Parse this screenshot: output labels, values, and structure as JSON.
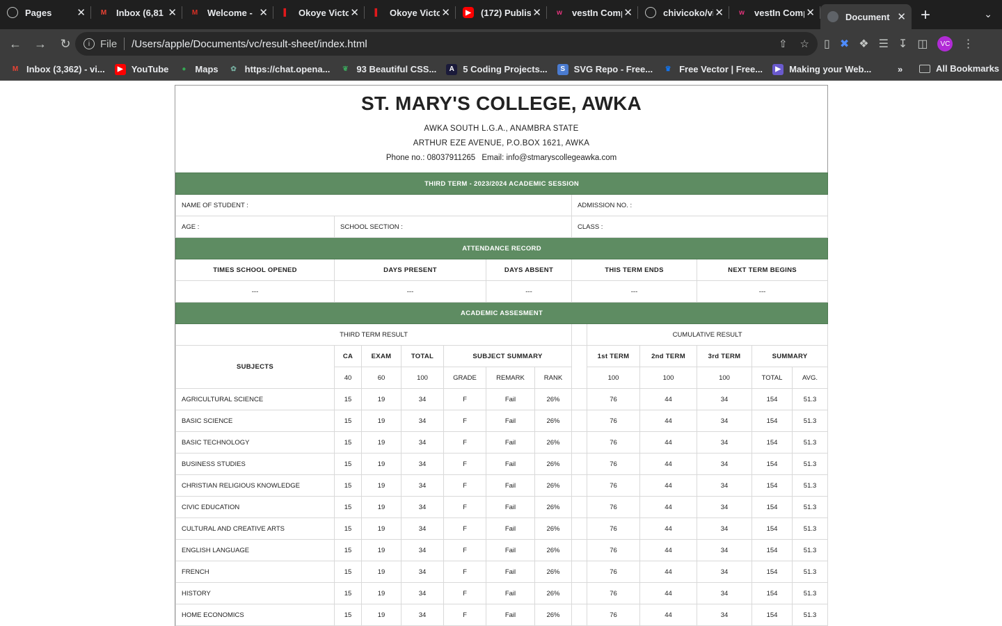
{
  "browser": {
    "tabs": [
      {
        "title": "Pages",
        "icon": "github-icon",
        "active": false
      },
      {
        "title": "Inbox (6,81",
        "icon": "gmail-icon",
        "active": false
      },
      {
        "title": "Welcome -",
        "icon": "mail-icon",
        "active": false
      },
      {
        "title": "Okoye Victo",
        "icon": "red-bar-icon",
        "active": false
      },
      {
        "title": "Okoye Victo",
        "icon": "red-bar-icon",
        "active": false
      },
      {
        "title": "(172) Publis",
        "icon": "youtube-icon",
        "active": false
      },
      {
        "title": "vestIn Comp",
        "icon": "w-icon",
        "active": false
      },
      {
        "title": "chivicoko/vi",
        "icon": "github-icon",
        "active": false
      },
      {
        "title": "vestIn Comp",
        "icon": "w-icon",
        "active": false
      },
      {
        "title": "Document",
        "icon": "globe-icon",
        "active": true
      }
    ],
    "new_tab": "+",
    "address": {
      "scheme": "File",
      "url": "/Users/apple/Documents/vc/result-sheet/index.html"
    },
    "profile_initials": "VC",
    "bookmarks": [
      {
        "label": "Inbox (3,362) - vi...",
        "icon": "gmail-icon"
      },
      {
        "label": "YouTube",
        "icon": "youtube-icon"
      },
      {
        "label": "Maps",
        "icon": "maps-icon"
      },
      {
        "label": "https://chat.opena...",
        "icon": "chatgpt-icon"
      },
      {
        "label": "93 Beautiful CSS...",
        "icon": "css-icon"
      },
      {
        "label": "5 Coding Projects...",
        "icon": "coding-icon"
      },
      {
        "label": "SVG Repo - Free...",
        "icon": "svgrepo-icon"
      },
      {
        "label": "Free Vector | Free...",
        "icon": "freepik-icon"
      },
      {
        "label": "Making your Web...",
        "icon": "web-icon"
      }
    ],
    "more_bookmarks": "»",
    "all_bookmarks": "All Bookmarks"
  },
  "school": {
    "name": "ST. MARY'S COLLEGE, AWKA",
    "lga": "AWKA SOUTH L.G.A., ANAMBRA STATE",
    "address": "ARTHUR EZE AVENUE, P.O.BOX 1621, AWKA",
    "phone": "Phone no.: 08037911265",
    "email": "Email: info@stmaryscollegeawka.com"
  },
  "session": "THIRD TERM - 2023/2024 ACADEMIC SESSION",
  "student": {
    "name_label": "NAME OF STUDENT :",
    "admission_label": "ADMISSION NO. :",
    "age_label": "AGE :",
    "section_label": "SCHOOL SECTION :",
    "class_label": "CLASS :"
  },
  "attendance": {
    "title": "ATTENDANCE RECORD",
    "headers": [
      "TIMES SCHOOL OPENED",
      "DAYS PRESENT",
      "DAYS ABSENT",
      "THIS TERM ENDS",
      "NEXT TERM BEGINS"
    ],
    "values": [
      "---",
      "---",
      "---",
      "---",
      "---"
    ]
  },
  "assessment": {
    "title": "ACADEMIC ASSESMENT",
    "third_term_label": "THIRD TERM RESULT",
    "cumulative_label": "CUMULATIVE RESULT",
    "subjects_label": "SUBJECTS",
    "headers": {
      "ca": "CA",
      "exam": "EXAM",
      "total": "TOTAL",
      "summary": "SUBJECT SUMMARY",
      "t1": "1st TERM",
      "t2": "2nd TERM",
      "t3": "3rd TERM",
      "cum_summary": "SUMMARY"
    },
    "subheaders": {
      "ca": "40",
      "exam": "60",
      "total": "100",
      "grade": "GRADE",
      "remark": "REMARK",
      "rank": "RANK",
      "t1": "100",
      "t2": "100",
      "t3": "100",
      "cum_total": "TOTAL",
      "avg": "AVG."
    },
    "rows": [
      {
        "subject": "AGRICULTURAL SCIENCE",
        "ca": "15",
        "exam": "19",
        "total": "34",
        "grade": "F",
        "remark": "Fail",
        "rank": "26%",
        "t1": "76",
        "t2": "44",
        "t3": "34",
        "cum_total": "154",
        "avg": "51.3"
      },
      {
        "subject": "BASIC SCIENCE",
        "ca": "15",
        "exam": "19",
        "total": "34",
        "grade": "F",
        "remark": "Fail",
        "rank": "26%",
        "t1": "76",
        "t2": "44",
        "t3": "34",
        "cum_total": "154",
        "avg": "51.3"
      },
      {
        "subject": "BASIC TECHNOLOGY",
        "ca": "15",
        "exam": "19",
        "total": "34",
        "grade": "F",
        "remark": "Fail",
        "rank": "26%",
        "t1": "76",
        "t2": "44",
        "t3": "34",
        "cum_total": "154",
        "avg": "51.3"
      },
      {
        "subject": "BUSINESS STUDIES",
        "ca": "15",
        "exam": "19",
        "total": "34",
        "grade": "F",
        "remark": "Fail",
        "rank": "26%",
        "t1": "76",
        "t2": "44",
        "t3": "34",
        "cum_total": "154",
        "avg": "51.3"
      },
      {
        "subject": "CHRISTIAN RELIGIOUS KNOWLEDGE",
        "ca": "15",
        "exam": "19",
        "total": "34",
        "grade": "F",
        "remark": "Fail",
        "rank": "26%",
        "t1": "76",
        "t2": "44",
        "t3": "34",
        "cum_total": "154",
        "avg": "51.3"
      },
      {
        "subject": "CIVIC EDUCATION",
        "ca": "15",
        "exam": "19",
        "total": "34",
        "grade": "F",
        "remark": "Fail",
        "rank": "26%",
        "t1": "76",
        "t2": "44",
        "t3": "34",
        "cum_total": "154",
        "avg": "51.3"
      },
      {
        "subject": "CULTURAL AND CREATIVE ARTS",
        "ca": "15",
        "exam": "19",
        "total": "34",
        "grade": "F",
        "remark": "Fail",
        "rank": "26%",
        "t1": "76",
        "t2": "44",
        "t3": "34",
        "cum_total": "154",
        "avg": "51.3"
      },
      {
        "subject": "ENGLISH LANGUAGE",
        "ca": "15",
        "exam": "19",
        "total": "34",
        "grade": "F",
        "remark": "Fail",
        "rank": "26%",
        "t1": "76",
        "t2": "44",
        "t3": "34",
        "cum_total": "154",
        "avg": "51.3"
      },
      {
        "subject": "FRENCH",
        "ca": "15",
        "exam": "19",
        "total": "34",
        "grade": "F",
        "remark": "Fail",
        "rank": "26%",
        "t1": "76",
        "t2": "44",
        "t3": "34",
        "cum_total": "154",
        "avg": "51.3"
      },
      {
        "subject": "HISTORY",
        "ca": "15",
        "exam": "19",
        "total": "34",
        "grade": "F",
        "remark": "Fail",
        "rank": "26%",
        "t1": "76",
        "t2": "44",
        "t3": "34",
        "cum_total": "154",
        "avg": "51.3"
      },
      {
        "subject": "HOME ECONOMICS",
        "ca": "15",
        "exam": "19",
        "total": "34",
        "grade": "F",
        "remark": "Fail",
        "rank": "26%",
        "t1": "76",
        "t2": "44",
        "t3": "34",
        "cum_total": "154",
        "avg": "51.3"
      },
      {
        "subject": "",
        "ca": "",
        "exam": "",
        "total": "",
        "grade": "",
        "remark": "",
        "rank": "",
        "t1": "",
        "t2": "",
        "t3": "",
        "cum_total": "",
        "avg": ""
      }
    ]
  },
  "colors": {
    "band": "#5e8c62",
    "chrome_dark": "#1f1f1f",
    "chrome_toolbar": "#3c3c3c"
  }
}
